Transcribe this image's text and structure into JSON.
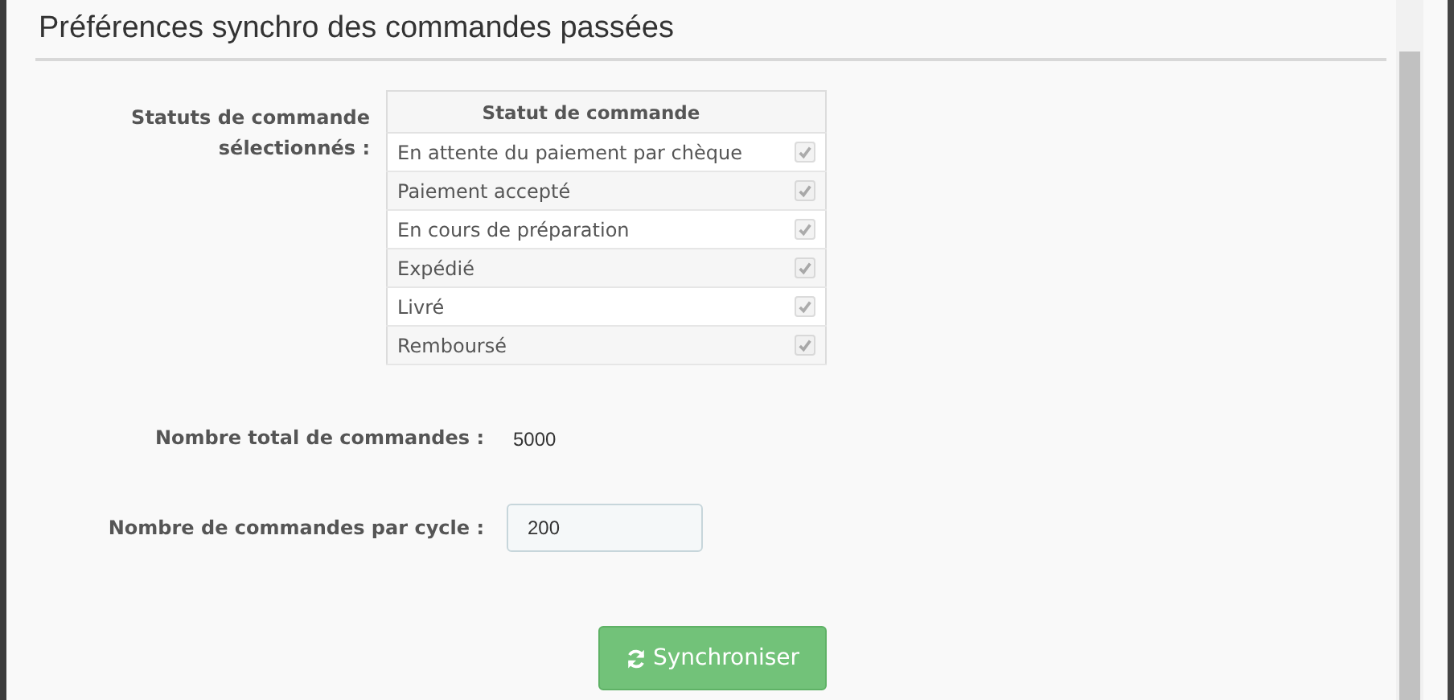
{
  "title": "Préférences synchro des commandes passées",
  "statuses": {
    "label": "Statuts de commande sélectionnés :",
    "column": "Statut de commande",
    "rows": [
      {
        "name": "En attente du paiement par chèque",
        "checked": true,
        "disabled": true
      },
      {
        "name": "Paiement accepté",
        "checked": true,
        "disabled": true
      },
      {
        "name": "En cours de préparation",
        "checked": true,
        "disabled": true
      },
      {
        "name": "Expédié",
        "checked": true,
        "disabled": true
      },
      {
        "name": "Livré",
        "checked": true,
        "disabled": true
      },
      {
        "name": "Remboursé",
        "checked": true,
        "disabled": true
      }
    ]
  },
  "total": {
    "label": "Nombre total de commandes :",
    "value": "5000"
  },
  "per_cycle": {
    "label": "Nombre de commandes par cycle :",
    "value": "200"
  },
  "button": "Synchroniser"
}
